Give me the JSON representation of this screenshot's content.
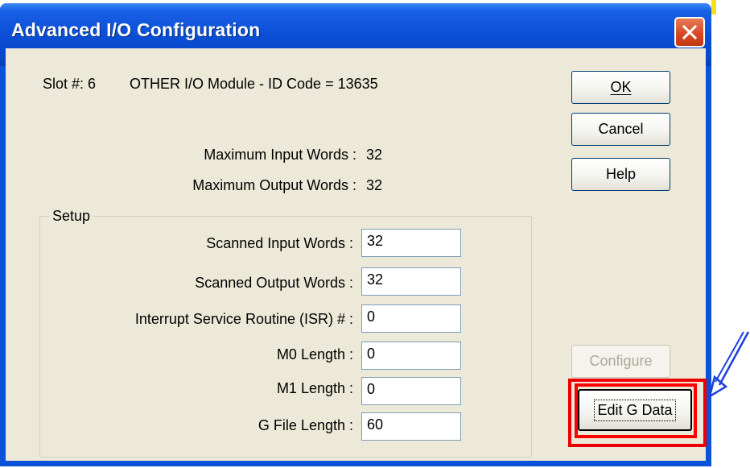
{
  "window": {
    "title": "Advanced I/O Configuration"
  },
  "slot": {
    "label": "Slot #: 6",
    "module_text": "OTHER I/O Module - ID Code = 13635"
  },
  "limits": {
    "max_input_label": "Maximum Input Words :",
    "max_input_value": "32",
    "max_output_label": "Maximum Output Words :",
    "max_output_value": "32"
  },
  "setup": {
    "title": "Setup",
    "fields": [
      {
        "label": "Scanned Input Words :",
        "value": "32"
      },
      {
        "label": "Scanned Output Words :",
        "value": "32"
      },
      {
        "label": "Interrupt Service Routine (ISR) # :",
        "value": "0"
      },
      {
        "label": "M0  Length :",
        "value": "0"
      },
      {
        "label": "M1  Length :",
        "value": "0"
      },
      {
        "label": "G File Length :",
        "value": "60"
      }
    ]
  },
  "buttons": {
    "ok": "OK",
    "cancel": "Cancel",
    "help": "Help",
    "configure": "Configure",
    "edit_g_data": "Edit G Data"
  },
  "colors": {
    "titlebar": "#0a4fd6",
    "dialog_bg": "#ece9d8",
    "highlight": "#ff0000",
    "arrow": "#1a3fe0"
  },
  "icons": {
    "close": "close-x-icon",
    "annotation": "arrow-pointer-icon"
  }
}
